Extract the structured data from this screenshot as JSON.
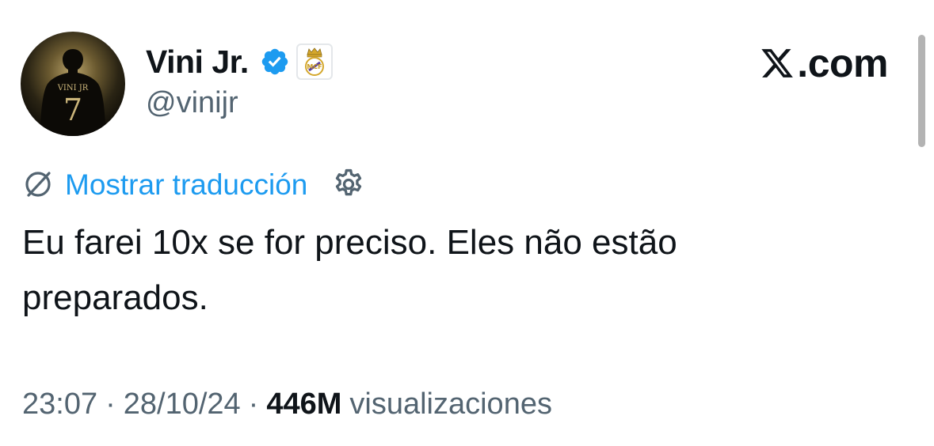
{
  "profile": {
    "display_name": "Vini Jr.",
    "handle": "@vinijr",
    "avatar_jersey_text": "VINI JR",
    "avatar_jersey_number": "7",
    "verified_icon": "verified-badge-icon",
    "affiliate_icon": "real-madrid-crest-icon"
  },
  "brand": {
    "logo_icon": "x-logo-icon",
    "suffix": ".com"
  },
  "translation": {
    "icon": "globe-slash-icon",
    "label": "Mostrar traducción",
    "settings_icon": "gear-icon"
  },
  "tweet": {
    "text_line1": "Eu farei 10x se for preciso. Eles não estão",
    "text_line2": "preparados."
  },
  "meta": {
    "time": "23:07",
    "separator": "·",
    "date": "28/10/24",
    "views_count": "446M",
    "views_label": "visualizaciones"
  },
  "colors": {
    "link": "#1d9bf0",
    "secondary_text": "#536471",
    "primary_text": "#0f1419",
    "verified": "#1d9bf0"
  }
}
